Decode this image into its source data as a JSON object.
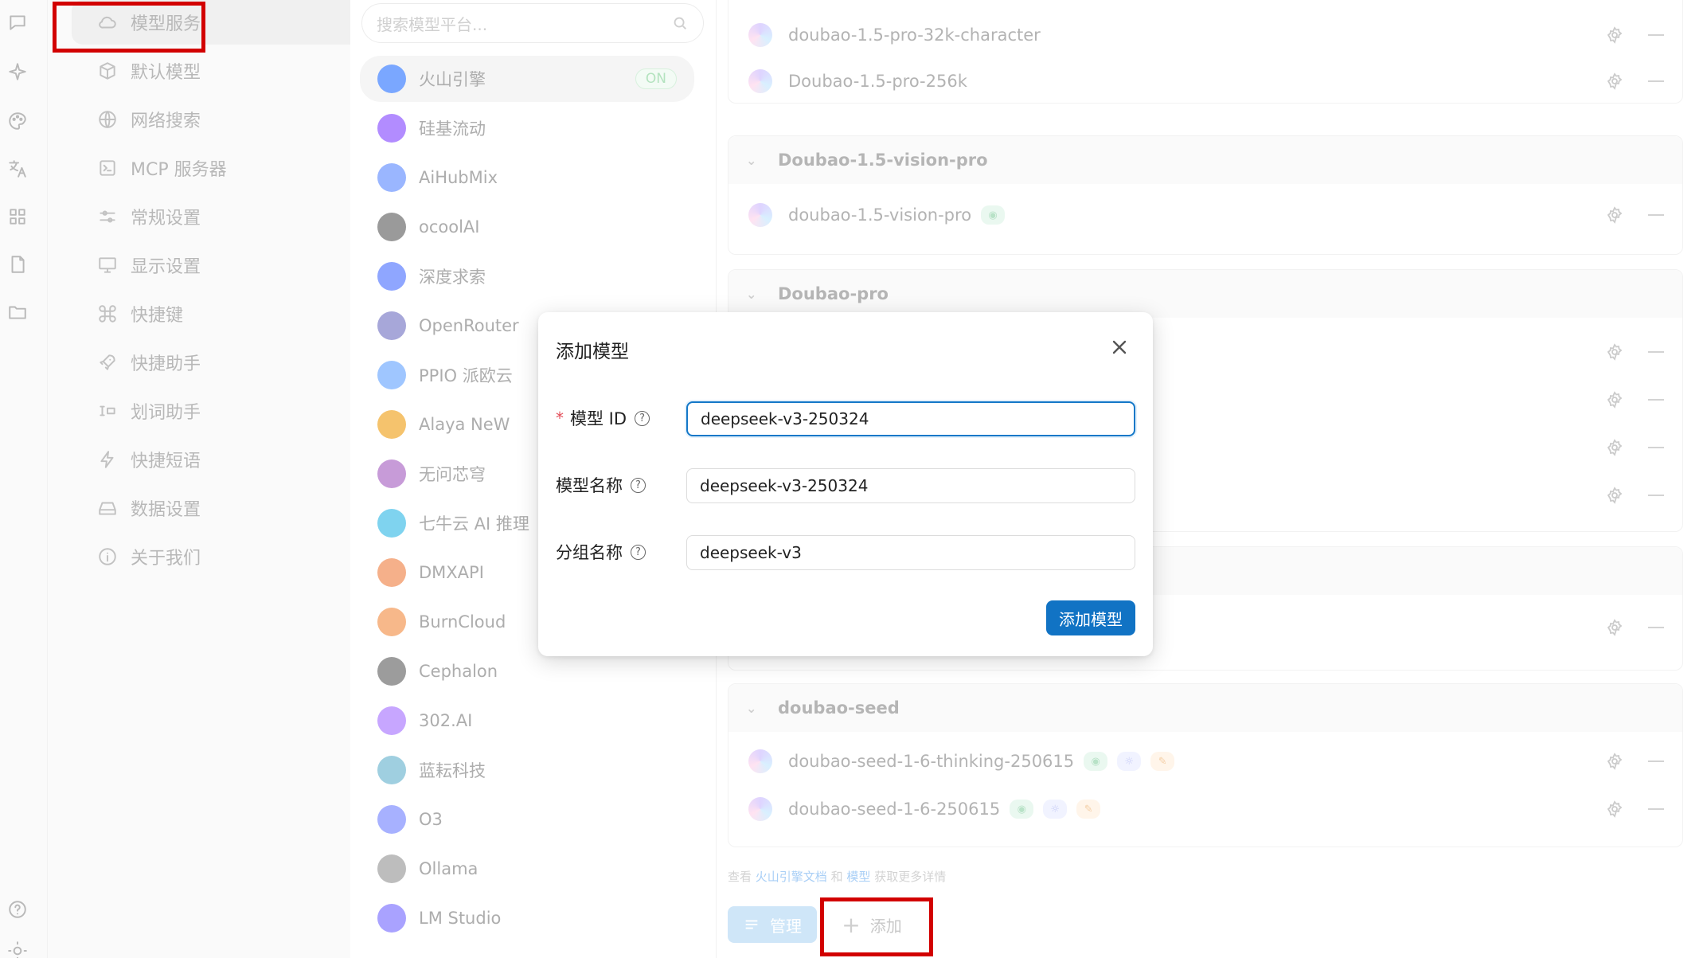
{
  "rail": {
    "icons": [
      "chat-icon",
      "sparkle-icon",
      "palette-icon",
      "translate-icon",
      "apps-icon",
      "file-icon",
      "folder-icon",
      "help-icon",
      "brightness-icon"
    ]
  },
  "settings_menu": {
    "items": [
      {
        "label": "模型服务",
        "icon": "cloud-icon",
        "active": true
      },
      {
        "label": "默认模型",
        "icon": "cube-icon"
      },
      {
        "label": "网络搜索",
        "icon": "globe-icon"
      },
      {
        "label": "MCP 服务器",
        "icon": "terminal-icon"
      },
      {
        "label": "常规设置",
        "icon": "sliders-icon"
      },
      {
        "label": "显示设置",
        "icon": "monitor-icon"
      },
      {
        "label": "快捷键",
        "icon": "command-icon"
      },
      {
        "label": "快捷助手",
        "icon": "rocket-icon"
      },
      {
        "label": "划词助手",
        "icon": "text-select-icon"
      },
      {
        "label": "快捷短语",
        "icon": "bolt-icon"
      },
      {
        "label": "数据设置",
        "icon": "drive-icon"
      },
      {
        "label": "关于我们",
        "icon": "info-icon"
      }
    ]
  },
  "providers": {
    "search_placeholder": "搜索模型平台...",
    "items": [
      {
        "name": "火山引擎",
        "status": "ON",
        "color": "#7aa7ff"
      },
      {
        "name": "硅基流动",
        "color": "#b28cff"
      },
      {
        "name": "AiHubMix",
        "color": "#9ab6ff"
      },
      {
        "name": "ocoolAI",
        "color": "#9a9a9a"
      },
      {
        "name": "深度求索",
        "color": "#8fa6ff"
      },
      {
        "name": "OpenRouter",
        "color": "#a7a7d9"
      },
      {
        "name": "PPIO 派欧云",
        "color": "#9fc6ff"
      },
      {
        "name": "Alaya NeW",
        "color": "#f5c36d"
      },
      {
        "name": "无问芯穹",
        "color": "#c79bd8"
      },
      {
        "name": "七牛云 AI 推理",
        "color": "#7fd3ef"
      },
      {
        "name": "DMXAPI",
        "color": "#f5b08a"
      },
      {
        "name": "BurnCloud",
        "color": "#f7b88a"
      },
      {
        "name": "Cephalon",
        "color": "#9c9c9c"
      },
      {
        "name": "302.AI",
        "color": "#c7a6ff"
      },
      {
        "name": "蓝耘科技",
        "color": "#9fcfe0"
      },
      {
        "name": "O3",
        "color": "#a7b1ff"
      },
      {
        "name": "Ollama",
        "color": "#bdbdbd"
      },
      {
        "name": "LM Studio",
        "color": "#a9a2ff"
      }
    ]
  },
  "models": {
    "top_rows": [
      "doubao-1.5-pro-32k-character",
      "Doubao-1.5-pro-256k"
    ],
    "groups": [
      {
        "name": "Doubao-1.5-vision-pro",
        "rows": [
          {
            "name": "doubao-1.5-vision-pro",
            "tags": [
              "vision"
            ]
          }
        ]
      },
      {
        "name": "Doubao-pro"
      },
      {
        "name": "doubao-seed",
        "rows": [
          {
            "name": "doubao-seed-1-6-thinking-250615",
            "tags": [
              "vision",
              "reason",
              "tool"
            ]
          },
          {
            "name": "doubao-seed-1-6-250615",
            "tags": [
              "vision",
              "reason",
              "tool"
            ]
          }
        ]
      }
    ],
    "hint_prefix": "查看",
    "hint_link1": "火山引擎文档",
    "hint_mid": "和",
    "hint_link2": "模型",
    "hint_suffix": "获取更多详情",
    "manage_label": "管理",
    "add_label": "添加"
  },
  "modal": {
    "title": "添加模型",
    "fields": [
      {
        "label": "模型 ID",
        "required": true,
        "value": "deepseek-v3-250324"
      },
      {
        "label": "模型名称",
        "value": "deepseek-v3-250324"
      },
      {
        "label": "分组名称",
        "value": "deepseek-v3"
      }
    ],
    "submit_label": "添加模型"
  },
  "colors": {
    "accent": "#1173c4",
    "highlight": "#d20000"
  }
}
